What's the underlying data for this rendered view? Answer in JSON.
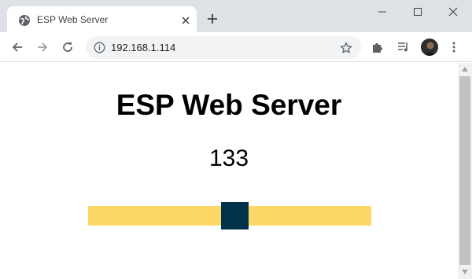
{
  "browser": {
    "tab_title": "ESP Web Server",
    "url": "192.168.1.114"
  },
  "page": {
    "title": "ESP Web Server",
    "slider": {
      "value": "133",
      "fraction": 0.52,
      "track_color": "#FED866",
      "thumb_color": "#003249"
    }
  },
  "icons": {
    "tab_favicon": "globe-icon",
    "tab_close": "close-icon",
    "new_tab": "plus-icon",
    "minimize": "minimize-icon",
    "maximize": "maximize-icon",
    "close_window": "close-icon",
    "back": "arrow-left-icon",
    "forward": "arrow-right-icon",
    "reload": "reload-icon",
    "site_info": "info-icon",
    "bookmark": "star-icon",
    "extensions": "puzzle-icon",
    "media": "media-queue-icon",
    "menu": "kebab-menu-icon"
  }
}
